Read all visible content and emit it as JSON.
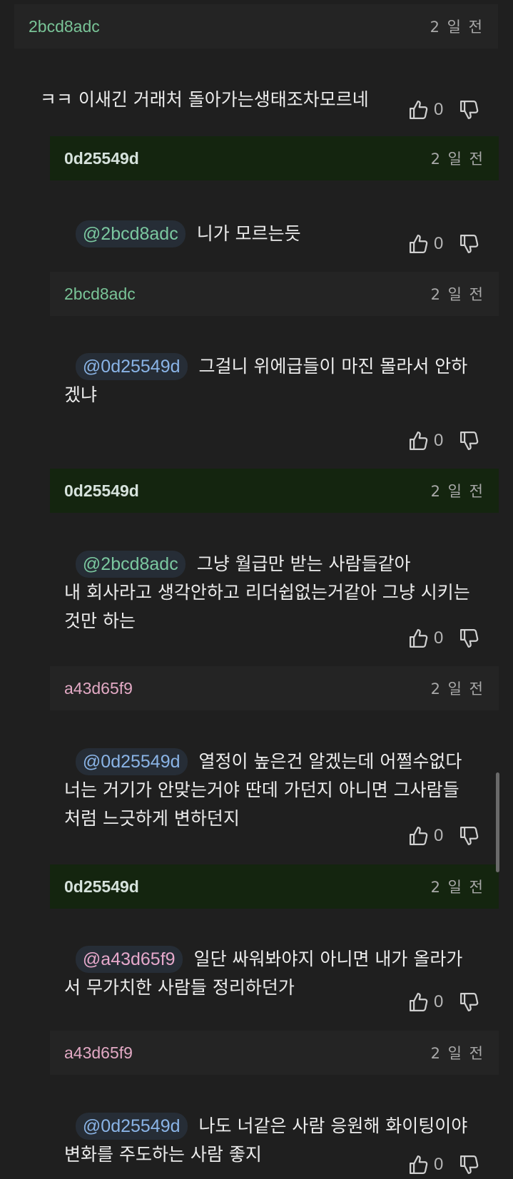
{
  "comments": [
    {
      "user": "2bcd8adc",
      "time": "2 일 전",
      "mention": "",
      "text": "ㅋㅋ 이새긴 거래처 돌아가는생태조차모르네",
      "likes": "0"
    },
    {
      "user": "0d25549d",
      "time": "2 일 전",
      "mention": "@2bcd8adc",
      "text": "니가 모르는듯",
      "likes": "0"
    },
    {
      "user": "2bcd8adc",
      "time": "2 일 전",
      "mention": "@0d25549d",
      "text": "그걸니 위에급들이 마진 몰라서 안하\n겠냐",
      "likes": "0"
    },
    {
      "user": "0d25549d",
      "time": "2 일 전",
      "mention": "@2bcd8adc",
      "text": "그냥 월급만 받는 사람들같아\n내 회사라고 생각안하고 리더쉽없는거같아 그냥 시키는\n것만 하는",
      "likes": "0"
    },
    {
      "user": "a43d65f9",
      "time": "2 일 전",
      "mention": "@0d25549d",
      "text": "열정이 높은건 알겠는데 어쩔수없다\n너는 거기가 안맞는거야 딴데 가던지 아니면 그사람들\n처럼 느긋하게 변하던지",
      "likes": "0"
    },
    {
      "user": "0d25549d",
      "time": "2 일 전",
      "mention": "@a43d65f9",
      "text": "일단 싸워봐야지 아니면 내가 올라가\n서 무가치한 사람들 정리하던가",
      "likes": "0"
    },
    {
      "user": "a43d65f9",
      "time": "2 일 전",
      "mention": "@0d25549d",
      "text": "나도 너같은 사람 응원해 화이팅이야\n변화를 주도하는 사람 좋지",
      "likes": "0"
    }
  ],
  "icons": {
    "like": "thumbs-up-icon",
    "dislike": "thumbs-down-icon"
  },
  "colors": {
    "background": "#1f1f1f",
    "op_header": "#14250f",
    "header": "#242424"
  }
}
